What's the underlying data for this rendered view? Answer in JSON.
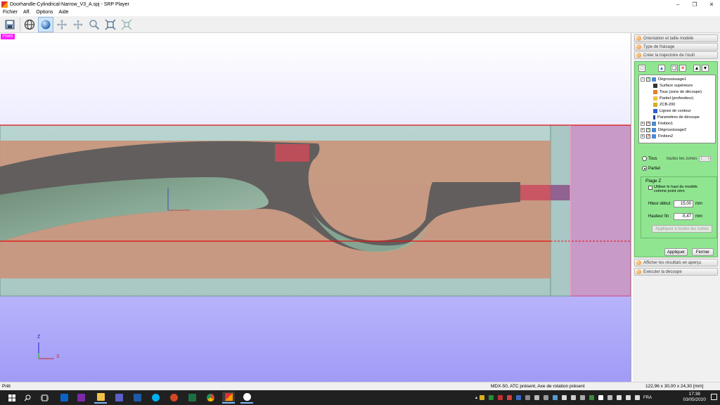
{
  "window": {
    "title": "Doorhandle-Cylindrical-Narrow_V3_A.spj - SRP Player",
    "controls": [
      "minimize",
      "maximize",
      "close"
    ]
  },
  "menu": [
    "Fichier",
    "Aff.",
    "Options",
    "Aide"
  ],
  "toolbar": {
    "buttons": [
      "save-icon",
      "globe-icon",
      "sphere-view-icon",
      "rotate-icon",
      "pan-icon",
      "zoom-icon",
      "fit-icon",
      "fit-all-icon"
    ],
    "active": "sphere-view-icon"
  },
  "viewport": {
    "view_label": "Front",
    "axis": {
      "z": "Z",
      "x": "X"
    }
  },
  "panel": {
    "sections": [
      "Orientation et taille modèle",
      "Type de fraisage",
      "Créer la trajectoire de l'outil"
    ],
    "tree": [
      {
        "label": "Dégrossissage1",
        "level": 0,
        "checked": true
      },
      {
        "label": "Surface supérieure",
        "level": 1
      },
      {
        "label": "Tous (zone de découpe)",
        "level": 1
      },
      {
        "label": "Partiel (profondeur)",
        "level": 1
      },
      {
        "label": "ZCB-200",
        "level": 1
      },
      {
        "label": "Lignes de contour",
        "level": 1
      },
      {
        "label": "Paramètres de découpe",
        "level": 1
      },
      {
        "label": "Finition1",
        "level": 0,
        "checked": true
      },
      {
        "label": "Dégrossissage2",
        "level": 0,
        "checked": true
      },
      {
        "label": "Finition2",
        "level": 0,
        "checked": true
      }
    ],
    "zone_options": {
      "all_label": "Tous",
      "all_zones_label": "toutes les zones",
      "zone_value": "1",
      "partial_label": "Partiel",
      "selected": "Partiel"
    },
    "plage_z": {
      "title": "Plage Z",
      "use_top_label": "Utiliser le haut du modèle comme point zéro",
      "start_label": "Hteur début :",
      "start_value": "15,00",
      "start_unit": "mm",
      "end_label": "Hauteur fin :",
      "end_value": "-5,47",
      "end_unit": "mm",
      "apply_all": "Appliquer à toutes les zones"
    },
    "apply": "Appliquer",
    "close": "Fermer",
    "bottom_sections": [
      "Afficher les résultats en aperçu",
      "Exécuter la découpe"
    ]
  },
  "status": {
    "left": "Prêt",
    "machine": "MDX-50, ATC présent, Axe de rotation présent",
    "size": "122,96 x 30,00 x 24,30 [mm]"
  },
  "taskbar": {
    "apps": [
      "start-icon",
      "search-icon",
      "task-view-icon",
      "outlook-icon",
      "onenote-icon",
      "file-explorer-icon",
      "teams-icon",
      "remote-desktop-icon",
      "skype-icon",
      "powerpoint-icon",
      "excel-icon",
      "chrome-icon",
      "srp-player-icon",
      "app-icon"
    ],
    "language": "FRA",
    "time": "17:38",
    "date": "03/05/2020",
    "colors": {
      "accent": "#7ab8f5",
      "bar": "#202020"
    }
  }
}
